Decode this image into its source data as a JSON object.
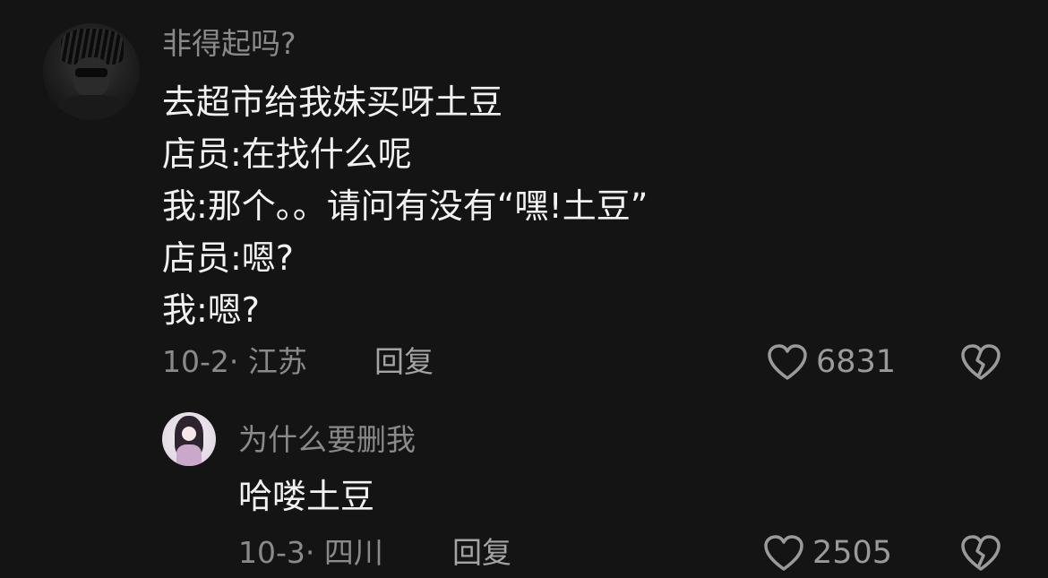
{
  "comments": [
    {
      "avatar": "user-avatar-dark-portrait",
      "username": "非得起吗?",
      "lines": [
        "去超市给我妹买呀土豆",
        "店员:在找什么呢",
        "我:那个。。请问有没有“嘿!土豆”",
        "店员:嗯?",
        "我:嗯?"
      ],
      "date_location": "10-2· 江苏",
      "reply_label": "回复",
      "like_count": "6831",
      "like_icon": "heart-icon",
      "dislike_icon": "broken-heart-icon"
    }
  ],
  "replies": [
    {
      "avatar": "user-avatar-anime-girl",
      "username": "为什么要删我",
      "lines": [
        "哈喽土豆"
      ],
      "date_location": "10-3· 四川",
      "reply_label": "回复",
      "like_count": "2505",
      "like_icon": "heart-icon",
      "dislike_icon": "broken-heart-icon"
    }
  ],
  "colors": {
    "background": "#141414",
    "text_primary": "#f2f2f2",
    "text_secondary": "#8a8a8a",
    "icon": "#9a9a9a"
  }
}
